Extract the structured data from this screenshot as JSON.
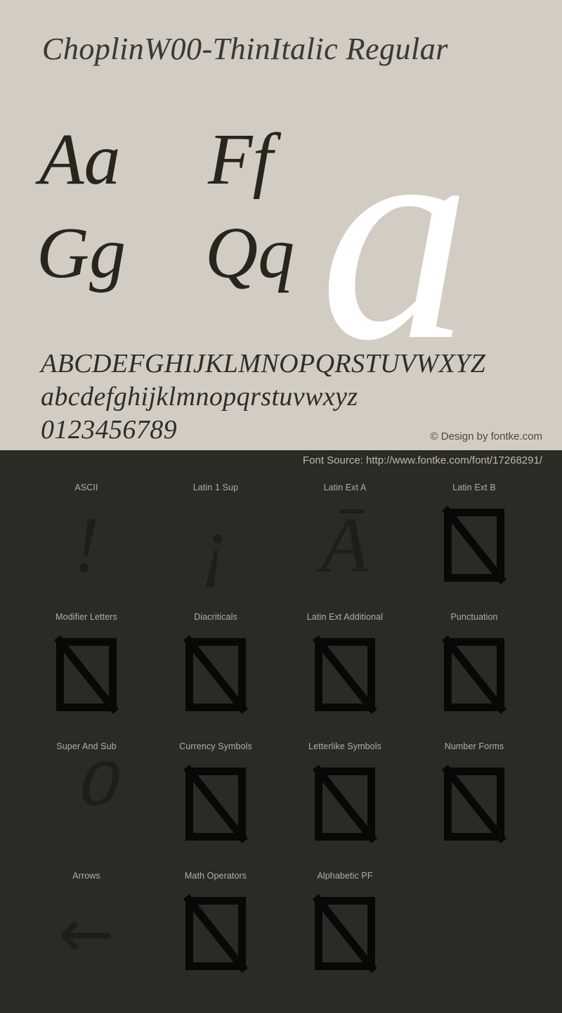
{
  "specimen": {
    "title": "ChoplinW00-ThinItalic Regular",
    "hero_glyph": "a",
    "letter_pairs": [
      "Aa",
      "Ff",
      "Gg",
      "Qq"
    ],
    "alphabet_uppercase": "ABCDEFGHIJKLMNOPQRSTUVWXYZ",
    "alphabet_lowercase": "abcdefghijklmnopqrstuvwxyz",
    "digits": "0123456789",
    "copyright": "© Design by fontke.com",
    "background_color": "#d2ccc2",
    "text_color": "#2e2e27",
    "hero_color": "#ffffff"
  },
  "coverage": {
    "font_source": "Font Source: http://www.fontke.com/font/17268291/",
    "background_color": "#2b2b26",
    "label_color": "#b2ada5",
    "glyph_color": "#1e1e19",
    "rows": [
      [
        {
          "label": "ASCII",
          "glyph": "!",
          "tofu": false
        },
        {
          "label": "Latin 1 Sup",
          "glyph": "¡",
          "tofu": false
        },
        {
          "label": "Latin Ext A",
          "glyph": "Ā",
          "tofu": false
        },
        {
          "label": "Latin Ext B",
          "glyph": "",
          "tofu": true
        }
      ],
      [
        {
          "label": "Modifier Letters",
          "glyph": "",
          "tofu": true
        },
        {
          "label": "Diacriticals",
          "glyph": "",
          "tofu": true
        },
        {
          "label": "Latin Ext Additional",
          "glyph": "",
          "tofu": true
        },
        {
          "label": "Punctuation",
          "glyph": "",
          "tofu": true
        }
      ],
      [
        {
          "label": "Super And Sub",
          "glyph": "⁰",
          "tofu": false
        },
        {
          "label": "Currency Symbols",
          "glyph": "",
          "tofu": true
        },
        {
          "label": "Letterlike Symbols",
          "glyph": "",
          "tofu": true
        },
        {
          "label": "Number Forms",
          "glyph": "",
          "tofu": true
        }
      ],
      [
        {
          "label": "Arrows",
          "glyph": "←",
          "tofu": false,
          "arrow": true
        },
        {
          "label": "Math Operators",
          "glyph": "",
          "tofu": true
        },
        {
          "label": "Alphabetic PF",
          "glyph": "",
          "tofu": true
        },
        {
          "label": "",
          "glyph": "",
          "tofu": false,
          "empty": true
        }
      ]
    ]
  }
}
